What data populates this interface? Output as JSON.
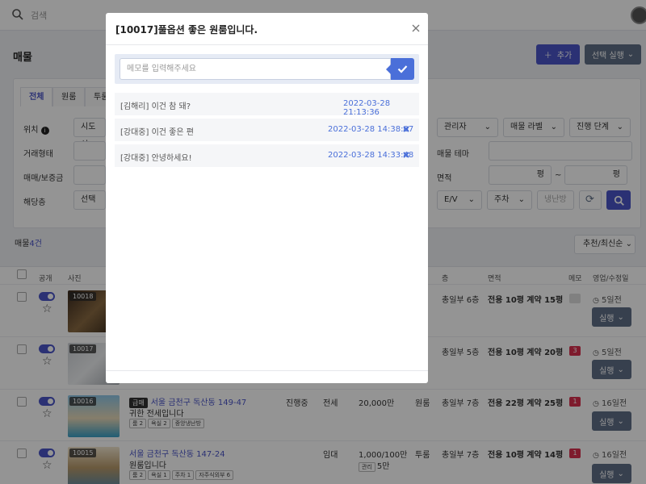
{
  "topbar": {
    "search_placeholder": "검색"
  },
  "page": {
    "title": "매물",
    "add_label": "추가",
    "run_selected_label": "선택 실행"
  },
  "filters": {
    "tabs": [
      "전체",
      "원룸",
      "투룸"
    ],
    "location_label": "위치",
    "location_select": "시도 선",
    "deal_type_label": "거래형태",
    "price_label": "매매/보증금",
    "floor_label": "해당층",
    "floor_select": "선택",
    "manager_select": "관리자",
    "property_label_select": "매물 라벨",
    "stage_select": "진행 단계",
    "theme_label": "매물 테마",
    "area_label": "면적",
    "pyeong_unit": "평",
    "tilde": "~",
    "ev_select": "E/V",
    "parking_select": "주차",
    "heating_placeholder": "냉난방"
  },
  "list": {
    "count_prefix": "매물",
    "count": "4건",
    "sort_label": "추천/최신순",
    "headers": {
      "public": "공개",
      "photo": "사진",
      "floor": "층",
      "area": "면적",
      "memo": "메모",
      "date": "영업/수정일"
    },
    "run_label": "실행",
    "rows": [
      {
        "id": "10018",
        "floor": "총일부 6층",
        "area_exclusive": "전용 10평",
        "area_contract": "계약 15평",
        "memo_count": "",
        "time": "5일전"
      },
      {
        "id": "10017",
        "floor": "총일부 5층",
        "area_exclusive": "전용 10평",
        "area_contract": "계약 20평",
        "memo_count": "3",
        "time": "5일전"
      },
      {
        "id": "10016",
        "badge": "급매",
        "address": "서울 금천구 독산동 149-47",
        "desc": "귀한 전세입니다",
        "chips": [
          "룸 2",
          "욕실 2",
          "중앙냉난방"
        ],
        "stage": "진행중",
        "deal": "전세",
        "price": "20,000만",
        "room_type": "원룸",
        "floor": "총일부 7층",
        "area_exclusive": "전용 22평",
        "area_contract": "계약 25평",
        "memo_count": "1",
        "time": "16일전"
      },
      {
        "id": "10015",
        "address": "서울 금천구 독산동 147-24",
        "desc": "원룸입니다",
        "chips": [
          "룸 2",
          "욕실 1",
          "주차 1",
          "자주식외부 6"
        ],
        "deal": "임대",
        "price": "1,000/100만",
        "fee_label": "관리",
        "fee": "5만",
        "room_type": "투룸",
        "floor": "총일부 7층",
        "area_exclusive": "전용 10평",
        "area_contract": "계약 14평",
        "memo_count": "1",
        "time": "16일전"
      }
    ]
  },
  "modal": {
    "title": "[10017]풀옵션 좋은 원룸입니다.",
    "input_placeholder": "메모를 입력해주세요",
    "memos": [
      {
        "text": "[김해리] 이건 참 돼?",
        "date": "2022-03-28 21:13:36",
        "deletable": false
      },
      {
        "text": "[강대중] 이건 좋은 편",
        "date": "2022-03-28 14:38:07",
        "deletable": true
      },
      {
        "text": "[강대중] 안녕하세요!",
        "date": "2022-03-28 14:33:48",
        "deletable": true
      }
    ]
  },
  "colors": {
    "accent": "#4a55c8",
    "run_button": "#5f6e87",
    "memo_badge": "#d9304f",
    "date_blue": "#4a6fd9"
  }
}
